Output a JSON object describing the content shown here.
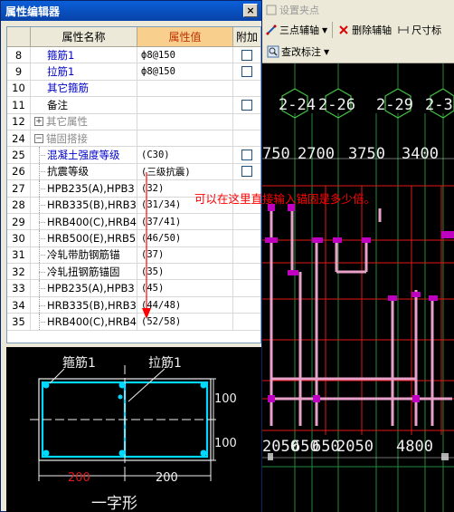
{
  "window": {
    "title": "属性编辑器",
    "close_label": "×"
  },
  "grid": {
    "headers": {
      "name": "属性名称",
      "value": "属性值",
      "add": "附加"
    },
    "rows": [
      {
        "no": "8",
        "name": "箍筋1",
        "value": "ф8@150",
        "style": "blue",
        "check": true
      },
      {
        "no": "9",
        "name": "拉筋1",
        "value": "ф8@150",
        "style": "blue",
        "check": true
      },
      {
        "no": "10",
        "name": "其它箍筋",
        "value": "",
        "style": "blue",
        "check": false
      },
      {
        "no": "11",
        "name": "备注",
        "value": "",
        "style": "plain",
        "check": true
      },
      {
        "no": "12",
        "name": "其它属性",
        "value": "",
        "style": "group",
        "expander": "+",
        "check": false
      },
      {
        "no": "24",
        "name": "锚固搭接",
        "value": "",
        "style": "group",
        "expander": "−",
        "check": false
      },
      {
        "no": "25",
        "name": "混凝土强度等级",
        "value": "(C30)",
        "style": "blue-indent",
        "check": true
      },
      {
        "no": "26",
        "name": "抗震等级",
        "value": "(三级抗震)",
        "style": "plain-indent",
        "check": true
      },
      {
        "no": "27",
        "name": "HPB235(A),HPB3",
        "value": "(32)",
        "style": "plain-indent",
        "check": false
      },
      {
        "no": "28",
        "name": "HRB335(B),HRB3",
        "value": "(31/34)",
        "style": "plain-indent",
        "check": false
      },
      {
        "no": "29",
        "name": "HRB400(C),HRB4",
        "value": "(37/41)",
        "style": "plain-indent",
        "check": false
      },
      {
        "no": "30",
        "name": "HRB500(E),HRB5",
        "value": "(46/50)",
        "style": "plain-indent",
        "check": false
      },
      {
        "no": "31",
        "name": "冷轧带肋钢筋锚",
        "value": "(37)",
        "style": "plain-indent",
        "check": false
      },
      {
        "no": "32",
        "name": "冷轧扭钢筋锚固",
        "value": "(35)",
        "style": "plain-indent",
        "check": false
      },
      {
        "no": "33",
        "name": "HPB235(A),HPB3",
        "value": "(45)",
        "style": "plain-indent",
        "check": false
      },
      {
        "no": "34",
        "name": "HRB335(B),HRB3",
        "value": "(44/48)",
        "style": "plain-indent",
        "check": false
      },
      {
        "no": "35",
        "name": "HRB400(C),HRB4",
        "value": "(52/58)",
        "style": "plain-indent",
        "check": false
      }
    ]
  },
  "annotation": {
    "text": "可以在这里直接输入锚固是多少倍。",
    "color": "#ff0000"
  },
  "preview": {
    "label_stirrup": "箍筋1",
    "label_tie": "拉筋1",
    "dim_right_top": "100",
    "dim_right_bottom": "100",
    "dim_left": "200",
    "dim_right": "200",
    "section_name": "一字形"
  },
  "toolbar": {
    "row0_items": [
      "设置夹点"
    ],
    "three_point_aux": "三点辅轴",
    "delete_aux": "删除辅轴",
    "dim_label": "尺寸标",
    "query_label": "查改标注"
  },
  "cad": {
    "axis_labels": [
      "2-24",
      "2-26",
      "2-29",
      "2-3"
    ],
    "dims_top": [
      "750",
      "2700",
      "3750",
      "3400"
    ],
    "dims_bottom": [
      "2050",
      "650",
      "650",
      "2050",
      "4800"
    ]
  },
  "colors": {
    "accent_header": "#f9cf8e",
    "title_blue": "#0842a8",
    "cyan": "#00d8ff",
    "magenta": "#c000c0"
  }
}
